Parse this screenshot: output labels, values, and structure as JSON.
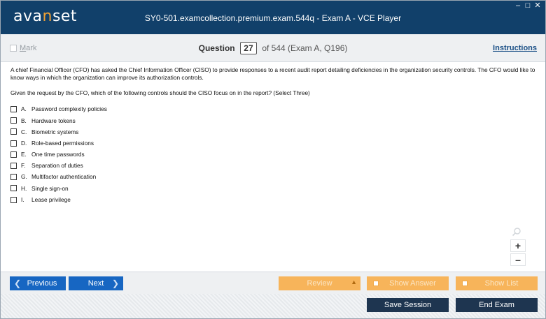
{
  "window": {
    "logo_pre": "ava",
    "logo_accent": "n",
    "logo_post": "set",
    "title": "SY0-501.examcollection.premium.exam.544q - Exam A - VCE Player",
    "minimize": "–",
    "maximize": "□",
    "close": "✕"
  },
  "header": {
    "mark_label": "Mark",
    "question_word": "Question",
    "question_number": "27",
    "of_text": "of 544 (Exam A, Q196)",
    "instructions": "Instructions"
  },
  "question": {
    "text": "A chief Financial Officer (CFO) has asked the Chief Information Officer (CISO) to provide responses to a recent audit report detailing deficiencies in the organization security controls. The CFO would like to know ways in which the organization can improve its authorization controls.",
    "prompt": "Given the request by the CFO, which of the following controls should the CISO focus on in the report? (Select Three)",
    "options": [
      {
        "letter": "A.",
        "text": "Password complexity policies"
      },
      {
        "letter": "B.",
        "text": "Hardware tokens"
      },
      {
        "letter": "C.",
        "text": "Biometric systems"
      },
      {
        "letter": "D.",
        "text": "Role-based permissions"
      },
      {
        "letter": "E.",
        "text": "One time passwords"
      },
      {
        "letter": "F.",
        "text": "Separation of duties"
      },
      {
        "letter": "G.",
        "text": "Multifactor authentication"
      },
      {
        "letter": "H.",
        "text": "Single sign-on"
      },
      {
        "letter": "I.",
        "text": "Lease privilege"
      }
    ]
  },
  "zoom": {
    "in": "+",
    "out": "–"
  },
  "nav": {
    "previous": "Previous",
    "next": "Next",
    "review": "Review",
    "show_answer": "Show Answer",
    "show_list": "Show List"
  },
  "footer": {
    "save_session": "Save Session",
    "end_exam": "End Exam"
  },
  "colors": {
    "titlebar": "#11406a",
    "accent_blue": "#1766c2",
    "accent_orange": "#f7b45a",
    "dark_button": "#1e3550"
  }
}
